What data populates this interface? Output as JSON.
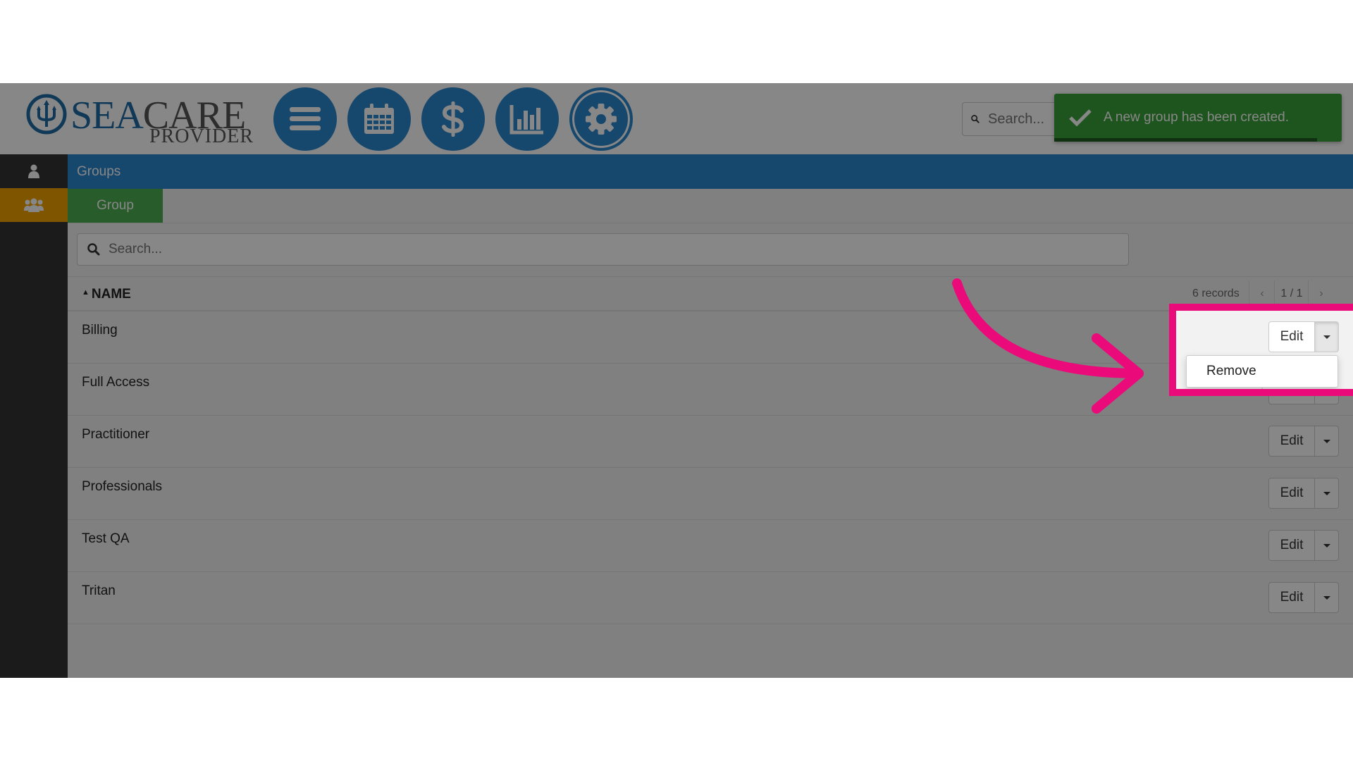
{
  "header": {
    "logo_brand_part1": "SEA",
    "logo_brand_part2": "CARE",
    "logo_sub": "PROVIDER",
    "nav": [
      {
        "name": "menu-icon"
      },
      {
        "name": "calendar-icon"
      },
      {
        "name": "dollar-icon"
      },
      {
        "name": "bar-chart-icon"
      },
      {
        "name": "gear-icon"
      }
    ],
    "search_placeholder": "Search..."
  },
  "toast": {
    "message": "A new group has been created.",
    "color": "#3aa13a"
  },
  "sidebar": {
    "items": [
      {
        "icon": "user-icon",
        "active": false
      },
      {
        "icon": "users-icon",
        "active": true
      }
    ],
    "active_color": "#f0a000"
  },
  "breadcrumb": "Groups",
  "tab": "Group",
  "list": {
    "search_placeholder": "Search...",
    "column": "NAME",
    "records": "6 records",
    "page": "1 / 1",
    "prev": "‹",
    "next": "›",
    "rows": [
      {
        "name": "Billing"
      },
      {
        "name": "Full Access"
      },
      {
        "name": "Practitioner"
      },
      {
        "name": "Professionals"
      },
      {
        "name": "Test QA"
      },
      {
        "name": "Tritan"
      }
    ],
    "edit_label": "Edit",
    "menu_item": "Remove"
  },
  "colors": {
    "accent": "#2a86cf",
    "highlight": "#ea0a7a",
    "tab_active": "#4caf50"
  }
}
